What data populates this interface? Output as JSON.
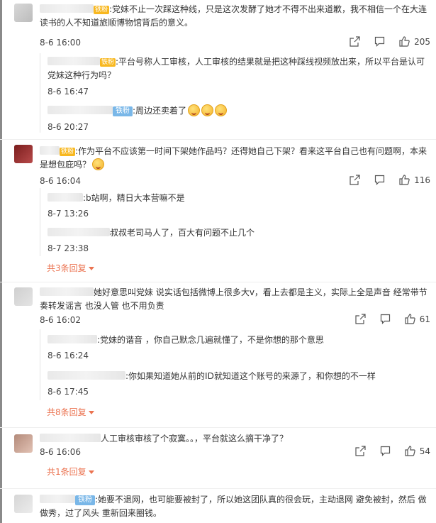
{
  "comments": [
    {
      "text": ":党妹不止一次踩这种线，只是这次发酵了她才不得不出来道歉，我不相信一个在大连读书的人不知道旅顺博物馆背后的意义。",
      "badge": "铁粉",
      "time": "8-6 16:00",
      "likes": "205",
      "replies": [
        {
          "text": ":平台号称人工审核，人工审核的结果就是把这种踩线视频放出来，所以平台是认可党妹这种行为吗？",
          "badge": "铁粉",
          "time": "8-6 16:47"
        },
        {
          "text": ":周边还卖着了",
          "badge": "铁粉",
          "time": "8-6 20:27"
        }
      ]
    },
    {
      "text": ":作为平台不应该第一时间下架她作品吗？还得她自己下架？看来这平台自己也有问题啊，本来是想包庇吗？",
      "badge": "铁粉",
      "time": "8-6 16:04",
      "likes": "116",
      "replies": [
        {
          "text": ":b站啊，精日大本营嘛不是",
          "time": "8-7 13:26"
        },
        {
          "text": "叔叔老司马人了，百大有问题不止几个",
          "time": "8-7 23:38"
        }
      ],
      "more": "共3条回复"
    },
    {
      "text": "她好意思叫党妹 说实话包括微博上很多大v，看上去都是主义，实际上全是声音 经常带节奏转发谣言 也没人管 也不用负责",
      "time": "8-6 16:02",
      "likes": "61",
      "replies": [
        {
          "text": ":党妹的谐音 ，你自己默念几遍就懂了，不是你想的那个意思",
          "time": "8-6 16:24"
        },
        {
          "text": ":你如果知道她从前的ID就知道这个账号的来源了，和你想的不一样",
          "time": "8-6 17:45"
        }
      ],
      "more": "共8条回复"
    },
    {
      "text": "人工审核审核了个寂寞。。，平台就这么摘干净了？",
      "time": "8-6 16:06",
      "likes": "54",
      "more": "共1条回复"
    },
    {
      "text": ":她要不退网，也可能要被封了，所以她这团队真的很会玩，主动退网 避免被封，然后 做做秀，过了风头 重新回来圈钱。",
      "badge": "铁粉"
    }
  ],
  "icons": {
    "share": "share-icon",
    "comment": "comment-icon",
    "like": "thumbs-up-icon",
    "more_caret": "caret-down-icon"
  },
  "colors": {
    "more_link": "#eb7350",
    "badge_gold": "#f8b820",
    "badge_blue": "#79b7e8"
  }
}
